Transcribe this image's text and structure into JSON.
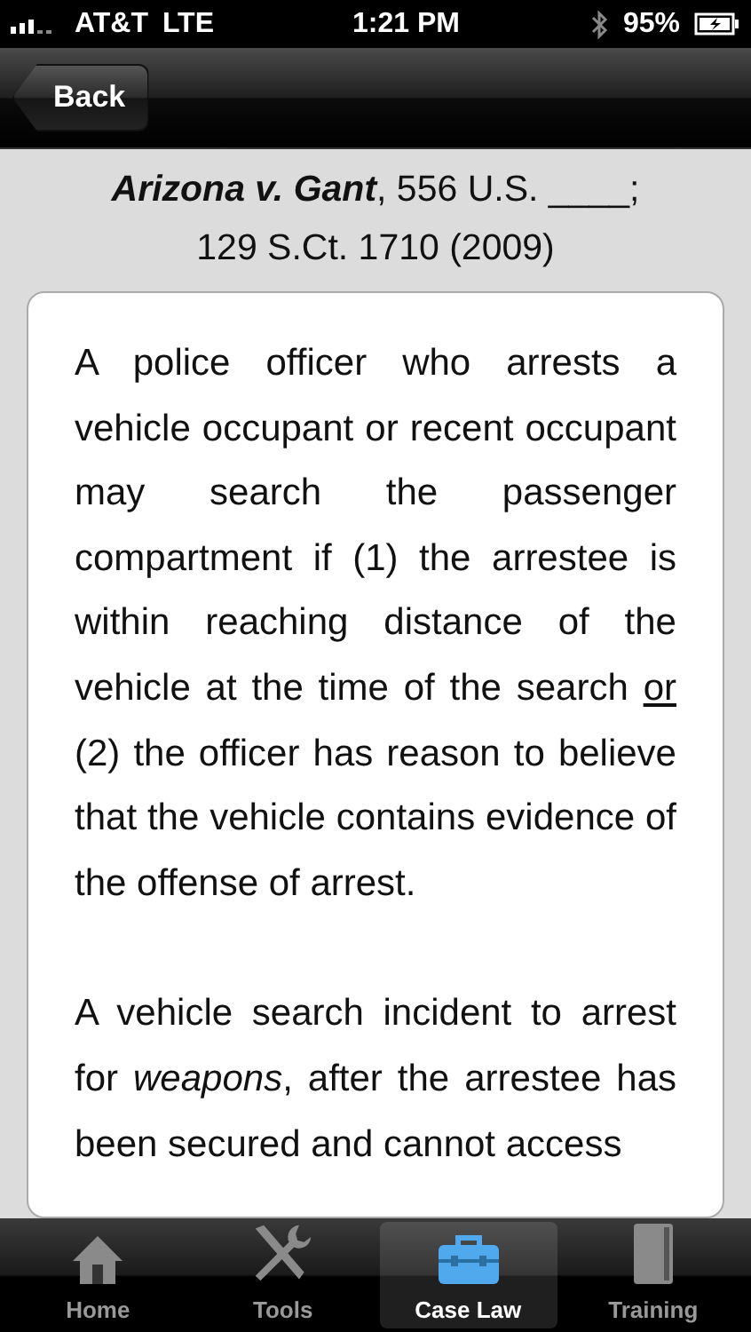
{
  "status_bar": {
    "carrier": "AT&T",
    "network": "LTE",
    "time": "1:21 PM",
    "battery": "95%"
  },
  "nav_bar": {
    "back": "Back"
  },
  "citation": [
    "**Arizona v. Gant**, 556 U.S. ____;",
    "129 S.Ct. 1710 (2009)"
  ],
  "paragraphs": [
    {
      "segments": [
        {
          "kind": "plain",
          "text": "A police officer who arrests a vehicle occupant or recent occupant may search the passenger compartment if (1) the arrestee is within reaching distance of the vehicle at the time of the search "
        },
        {
          "kind": "underlined",
          "text": "or"
        },
        {
          "kind": "plain",
          "text": " (2) the officer has reason to believe that the vehicle contains evidence of the offense of arrest."
        }
      ]
    },
    {
      "segments": [
        {
          "kind": "plain",
          "text": "A vehicle search incident to arrest for "
        },
        {
          "kind": "emphasis",
          "text": "weapons"
        },
        {
          "kind": "plain",
          "text": ", after the arrestee has been secured and cannot access"
        }
      ]
    }
  ],
  "tabs": [
    {
      "label": "Home",
      "selected": false
    },
    {
      "label": "Tools",
      "selected": false
    },
    {
      "label": "Case Law",
      "selected": true
    },
    {
      "label": "Training",
      "selected": false
    }
  ]
}
